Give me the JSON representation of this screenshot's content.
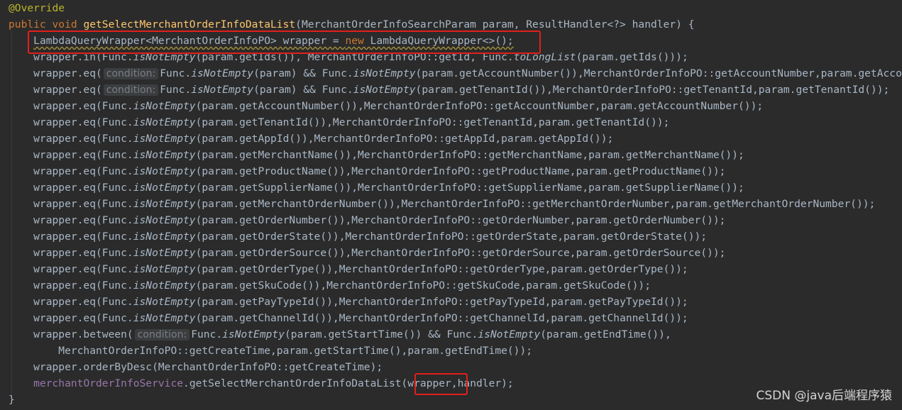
{
  "editor": {
    "theme": "darcula",
    "colors": {
      "background": "#2b2b2b",
      "keyword": "#cc7832",
      "annotation": "#bbb529",
      "method_decl": "#ffc66d",
      "field": "#9876aa",
      "default_text": "#a9b7c6",
      "hint_text": "#7a7e85",
      "highlight_box": "#e0201b"
    },
    "lines": [
      [
        {
          "t": "@Override",
          "c": "ann"
        }
      ],
      [
        {
          "t": "public void ",
          "c": "kw"
        },
        {
          "t": "getSelectMerchantOrderInfoDataList",
          "c": "fn"
        },
        {
          "t": "(MerchantOrderInfoSearchParam param, ResultHandler<?> handler) {"
        }
      ],
      [
        {
          "t": "    "
        },
        {
          "t": "LambdaQueryWrapper<MerchantOrderInfoPO> wrapper = ",
          "c": "sq"
        },
        {
          "t": "new ",
          "c": "kw sq"
        },
        {
          "t": "LambdaQueryWrapper<>();",
          "c": "sq"
        }
      ],
      [
        {
          "t": "    wrapper.in(Func."
        },
        {
          "t": "isNotEmpty",
          "c": "static"
        },
        {
          "t": "(param.getIds()), MerchantOrderInfoPO::getId, Func."
        },
        {
          "t": "toLongList",
          "c": "static"
        },
        {
          "t": "(param.getIds()));"
        }
      ],
      [
        {
          "t": "    wrapper.eq("
        },
        {
          "t": "condition:",
          "c": "hint"
        },
        {
          "t": "Func."
        },
        {
          "t": "isNotEmpty",
          "c": "static"
        },
        {
          "t": "(param) && Func."
        },
        {
          "t": "isNotEmpty",
          "c": "static"
        },
        {
          "t": "(param.getAccountNumber()),MerchantOrderInfoPO::getAccountNumber,param.getAccountNumber());"
        }
      ],
      [
        {
          "t": "    wrapper.eq("
        },
        {
          "t": "condition:",
          "c": "hint"
        },
        {
          "t": "Func."
        },
        {
          "t": "isNotEmpty",
          "c": "static"
        },
        {
          "t": "(param) && Func."
        },
        {
          "t": "isNotEmpty",
          "c": "static"
        },
        {
          "t": "(param.getTenantId()),MerchantOrderInfoPO::getTenantId,param.getTenantId());"
        }
      ],
      [
        {
          "t": "    wrapper.eq(Func."
        },
        {
          "t": "isNotEmpty",
          "c": "static"
        },
        {
          "t": "(param.getAccountNumber()),MerchantOrderInfoPO::getAccountNumber,param.getAccountNumber());"
        }
      ],
      [
        {
          "t": "    wrapper.eq(Func."
        },
        {
          "t": "isNotEmpty",
          "c": "static"
        },
        {
          "t": "(param.getTenantId()),MerchantOrderInfoPO::getTenantId,param.getTenantId());"
        }
      ],
      [
        {
          "t": "    wrapper.eq(Func."
        },
        {
          "t": "isNotEmpty",
          "c": "static"
        },
        {
          "t": "(param.getAppId()),MerchantOrderInfoPO::getAppId,param.getAppId());"
        }
      ],
      [
        {
          "t": "    wrapper.eq(Func."
        },
        {
          "t": "isNotEmpty",
          "c": "static"
        },
        {
          "t": "(param.getMerchantName()),MerchantOrderInfoPO::getMerchantName,param.getMerchantName());"
        }
      ],
      [
        {
          "t": "    wrapper.eq(Func."
        },
        {
          "t": "isNotEmpty",
          "c": "static"
        },
        {
          "t": "(param.getProductName()),MerchantOrderInfoPO::getProductName,param.getProductName());"
        }
      ],
      [
        {
          "t": "    wrapper.eq(Func."
        },
        {
          "t": "isNotEmpty",
          "c": "static"
        },
        {
          "t": "(param.getSupplierName()),MerchantOrderInfoPO::getSupplierName,param.getSupplierName());"
        }
      ],
      [
        {
          "t": "    wrapper.eq(Func."
        },
        {
          "t": "isNotEmpty",
          "c": "static"
        },
        {
          "t": "(param.getMerchantOrderNumber()),MerchantOrderInfoPO::getMerchantOrderNumber,param.getMerchantOrderNumber());"
        }
      ],
      [
        {
          "t": "    wrapper.eq(Func."
        },
        {
          "t": "isNotEmpty",
          "c": "static"
        },
        {
          "t": "(param.getOrderNumber()),MerchantOrderInfoPO::getOrderNumber,param.getOrderNumber());"
        }
      ],
      [
        {
          "t": "    wrapper.eq(Func."
        },
        {
          "t": "isNotEmpty",
          "c": "static"
        },
        {
          "t": "(param.getOrderState()),MerchantOrderInfoPO::getOrderState,param.getOrderState());"
        }
      ],
      [
        {
          "t": "    wrapper.eq(Func."
        },
        {
          "t": "isNotEmpty",
          "c": "static"
        },
        {
          "t": "(param.getOrderSource()),MerchantOrderInfoPO::getOrderSource,param.getOrderSource());"
        }
      ],
      [
        {
          "t": "    wrapper.eq(Func."
        },
        {
          "t": "isNotEmpty",
          "c": "static"
        },
        {
          "t": "(param.getOrderType()),MerchantOrderInfoPO::getOrderType,param.getOrderType());"
        }
      ],
      [
        {
          "t": "    wrapper.eq(Func."
        },
        {
          "t": "isNotEmpty",
          "c": "static"
        },
        {
          "t": "(param.getSkuCode()),MerchantOrderInfoPO::getSkuCode,param.getSkuCode());"
        }
      ],
      [
        {
          "t": "    wrapper.eq(Func."
        },
        {
          "t": "isNotEmpty",
          "c": "static"
        },
        {
          "t": "(param.getPayTypeId()),MerchantOrderInfoPO::getPayTypeId,param.getPayTypeId());"
        }
      ],
      [
        {
          "t": "    wrapper.eq(Func."
        },
        {
          "t": "isNotEmpty",
          "c": "static"
        },
        {
          "t": "(param.getChannelId()),MerchantOrderInfoPO::getChannelId,param.getChannelId());"
        }
      ],
      [
        {
          "t": "    wrapper.between("
        },
        {
          "t": "condition:",
          "c": "hint"
        },
        {
          "t": "Func."
        },
        {
          "t": "isNotEmpty",
          "c": "static"
        },
        {
          "t": "(param.getStartTime()) && Func."
        },
        {
          "t": "isNotEmpty",
          "c": "static"
        },
        {
          "t": "(param.getEndTime()),"
        }
      ],
      [
        {
          "t": "        MerchantOrderInfoPO::getCreateTime,param.getStartTime(),param.getEndTime());"
        }
      ],
      [
        {
          "t": "    wrapper.orderByDesc(MerchantOrderInfoPO::getCreateTime);"
        }
      ],
      [
        {
          "t": "    "
        },
        {
          "t": "merchantOrderInfoService",
          "c": "field"
        },
        {
          "t": ".getSelectMerchantOrderInfoDataList("
        },
        {
          "t": "wrapper"
        },
        {
          "t": ",handler);"
        }
      ],
      [
        {
          "t": "}"
        }
      ]
    ]
  },
  "watermark": "CSDN @java后端程序猿"
}
